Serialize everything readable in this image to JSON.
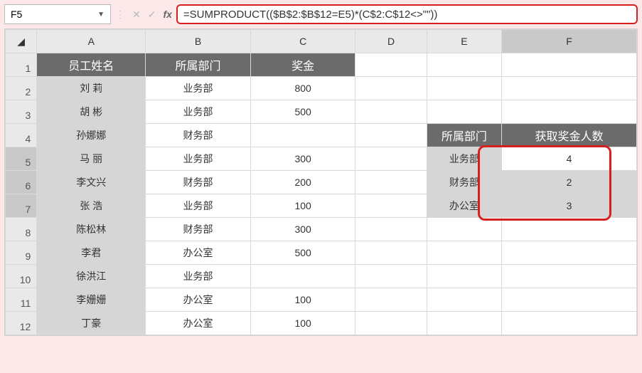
{
  "nameBox": "F5",
  "formula": "=SUMPRODUCT(($B$2:$B$12=E5)*(C$2:C$12<>\"\"))",
  "colHeaders": [
    "A",
    "B",
    "C",
    "D",
    "E",
    "F"
  ],
  "rowHeaders": [
    "1",
    "2",
    "3",
    "4",
    "5",
    "6",
    "7",
    "8",
    "9",
    "10",
    "11",
    "12"
  ],
  "selectedCol": "F",
  "selectedRows": [
    "5",
    "6",
    "7"
  ],
  "headerRow": {
    "A": "员工姓名",
    "B": "所属部门",
    "C": "奖金"
  },
  "summaryHeader": {
    "E": "所属部门",
    "F": "获取奖金人数"
  },
  "rows": [
    {
      "A": "刘 莉",
      "B": "业务部",
      "C": "800"
    },
    {
      "A": "胡 彬",
      "B": "业务部",
      "C": "500"
    },
    {
      "A": "孙娜娜",
      "B": "财务部",
      "C": ""
    },
    {
      "A": "马 丽",
      "B": "业务部",
      "C": "300"
    },
    {
      "A": "李文兴",
      "B": "财务部",
      "C": "200"
    },
    {
      "A": "张 浩",
      "B": "业务部",
      "C": "100"
    },
    {
      "A": "陈松林",
      "B": "财务部",
      "C": "300"
    },
    {
      "A": "李君",
      "B": "办公室",
      "C": "500"
    },
    {
      "A": "徐洪江",
      "B": "业务部",
      "C": ""
    },
    {
      "A": "李姗姗",
      "B": "办公室",
      "C": "100"
    },
    {
      "A": "丁豪",
      "B": "办公室",
      "C": "100"
    }
  ],
  "summary": [
    {
      "E": "业务部",
      "F": "4"
    },
    {
      "E": "财务部",
      "F": "2"
    },
    {
      "E": "办公室",
      "F": "3"
    }
  ]
}
